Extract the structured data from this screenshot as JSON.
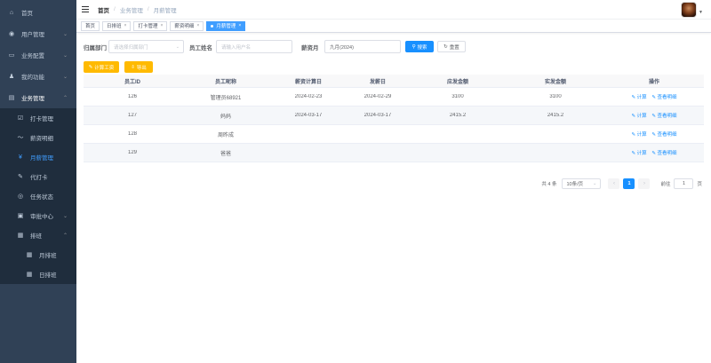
{
  "sidebar": {
    "items": [
      {
        "icon": "home-icon",
        "glyph": "⌂",
        "label": "首页"
      },
      {
        "icon": "user-icon",
        "glyph": "◉",
        "label": "用户管理"
      },
      {
        "icon": "monitor-icon",
        "glyph": "▭",
        "label": "业务配置"
      },
      {
        "icon": "person-icon",
        "glyph": "♟",
        "label": "我的功能"
      },
      {
        "icon": "document-icon",
        "glyph": "▤",
        "label": "业务管理"
      }
    ],
    "business_sub": [
      {
        "icon": "checkbox-icon",
        "glyph": "☑",
        "label": "打卡管理"
      },
      {
        "icon": "chevron-icon",
        "glyph": "〜",
        "label": "薪资明细"
      },
      {
        "icon": "yen-icon",
        "glyph": "¥",
        "label": "月薪管理"
      },
      {
        "icon": "pen-icon",
        "glyph": "✎",
        "label": "代打卡"
      },
      {
        "icon": "eye-icon",
        "glyph": "◎",
        "label": "任务状态"
      },
      {
        "icon": "approval-icon",
        "glyph": "▣",
        "label": "审批中心"
      },
      {
        "icon": "schedule-icon",
        "glyph": "▦",
        "label": "排班"
      }
    ],
    "schedule_sub": [
      {
        "icon": "grid-icon",
        "glyph": "▦",
        "label": "月排班"
      },
      {
        "icon": "grid-icon",
        "glyph": "▦",
        "label": "日排班"
      }
    ]
  },
  "breadcrumb": {
    "home": "首页",
    "level1": "业务管理",
    "level2": "月薪管理"
  },
  "tags": [
    {
      "label": "首页",
      "closable": false,
      "active": false
    },
    {
      "label": "日排班",
      "closable": true,
      "active": false
    },
    {
      "label": "打卡管理",
      "closable": true,
      "active": false
    },
    {
      "label": "薪资明细",
      "closable": true,
      "active": false
    },
    {
      "label": "月薪管理",
      "closable": true,
      "active": true
    }
  ],
  "filters": {
    "dept_label": "归属部门",
    "dept_placeholder": "请选择归属部门",
    "name_label": "员工姓名",
    "name_placeholder": "请输入用户名",
    "month_label": "薪资月",
    "month_value": "九月(2024)",
    "search_button": "搜索",
    "reset_button": "重置"
  },
  "actions": {
    "calc_button": "计算工资",
    "export_button": "导出"
  },
  "table": {
    "headers": [
      "员工ID",
      "员工昵称",
      "薪资计算日",
      "发薪日",
      "应发金额",
      "实发金额",
      "操作"
    ],
    "rows": [
      {
        "id": "126",
        "nickname": "管理员68921",
        "calc_date": "2024-02-23",
        "pay_date": "2024-02-29",
        "payable": "3100",
        "actual": "3100"
      },
      {
        "id": "127",
        "nickname": "妈妈",
        "calc_date": "2024-03-17",
        "pay_date": "2024-03-17",
        "payable": "2415.2",
        "actual": "2415.2"
      },
      {
        "id": "128",
        "nickname": "周昨成",
        "calc_date": "",
        "pay_date": "",
        "payable": "",
        "actual": ""
      },
      {
        "id": "129",
        "nickname": "爸爸",
        "calc_date": "",
        "pay_date": "",
        "payable": "",
        "actual": ""
      }
    ],
    "op_calc": "计算",
    "op_view": "查看明细"
  },
  "pagination": {
    "total": "共 4 条",
    "page_size": "10条/页",
    "current_page": "1",
    "goto_label": "前往",
    "goto_value": "1",
    "page_suffix": "页"
  },
  "colors": {
    "sidebar_bg": "#304156",
    "primary": "#1890ff",
    "warning": "#ffba00"
  }
}
